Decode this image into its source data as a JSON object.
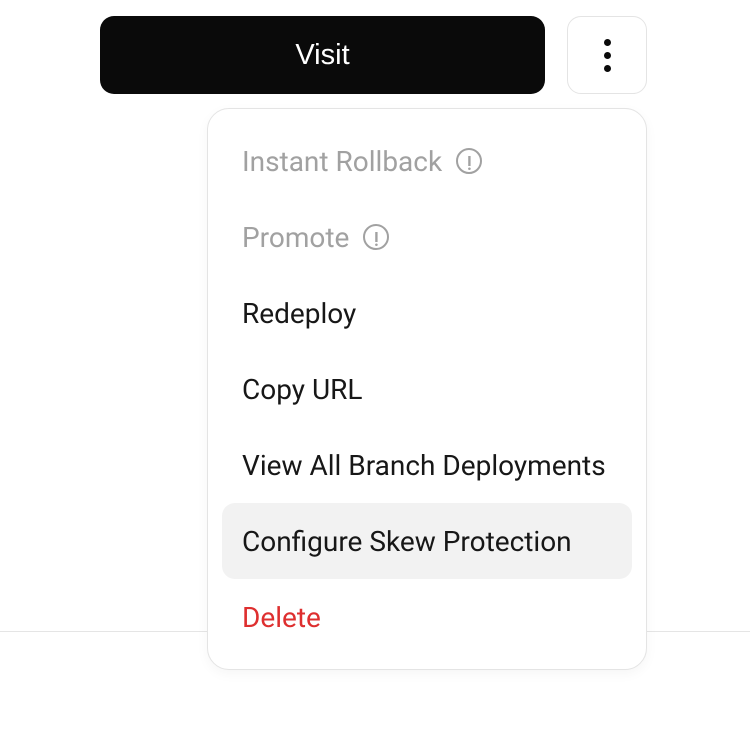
{
  "toolbar": {
    "visit_label": "Visit"
  },
  "menu": {
    "items": [
      {
        "label": "Instant Rollback",
        "disabled": true,
        "info": true,
        "danger": false,
        "highlighted": false
      },
      {
        "label": "Promote",
        "disabled": true,
        "info": true,
        "danger": false,
        "highlighted": false
      },
      {
        "label": "Redeploy",
        "disabled": false,
        "info": false,
        "danger": false,
        "highlighted": false
      },
      {
        "label": "Copy URL",
        "disabled": false,
        "info": false,
        "danger": false,
        "highlighted": false
      },
      {
        "label": "View All Branch Deployments",
        "disabled": false,
        "info": false,
        "danger": false,
        "highlighted": false
      },
      {
        "label": "Configure Skew Protection",
        "disabled": false,
        "info": false,
        "danger": false,
        "highlighted": true
      },
      {
        "label": "Delete",
        "disabled": false,
        "info": false,
        "danger": true,
        "highlighted": false
      }
    ]
  }
}
